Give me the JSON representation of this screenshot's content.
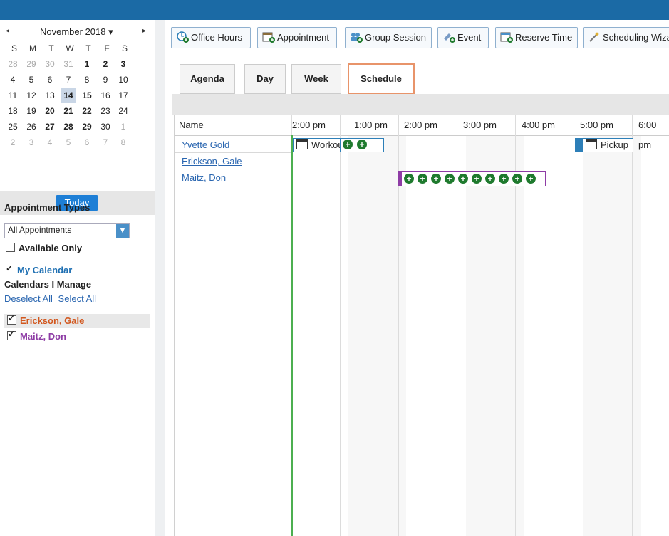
{
  "calendar": {
    "month_label": "November 2018 ▾",
    "prev": "◂",
    "next": "▸",
    "dow": [
      "S",
      "M",
      "T",
      "W",
      "T",
      "F",
      "S"
    ],
    "weeks": [
      [
        "28",
        "29",
        "30",
        "31",
        "1",
        "2",
        "3"
      ],
      [
        "4",
        "5",
        "6",
        "7",
        "8",
        "9",
        "10"
      ],
      [
        "11",
        "12",
        "13",
        "14",
        "15",
        "16",
        "17"
      ],
      [
        "18",
        "19",
        "20",
        "21",
        "22",
        "23",
        "24"
      ],
      [
        "25",
        "26",
        "27",
        "28",
        "29",
        "30",
        "1"
      ],
      [
        "2",
        "3",
        "4",
        "5",
        "6",
        "7",
        "8"
      ]
    ],
    "today_label": "Today"
  },
  "appointment_types": {
    "title": "Appointment Types",
    "selected": "All Appointments",
    "available_only": "Available Only"
  },
  "calendars": {
    "my_calendar": "My Calendar",
    "manage_title": "Calendars I Manage",
    "deselect_all": "Deselect All",
    "select_all": "Select All",
    "managed": [
      {
        "name": "Erickson, Gale",
        "color": "#d2571e"
      },
      {
        "name": "Maitz, Don",
        "color": "#8e3ca5"
      }
    ]
  },
  "toolbar": {
    "office_hours": "Office Hours",
    "appointment": "Appointment",
    "group_session": "Group Session",
    "event": "Event",
    "reserve_time": "Reserve Time",
    "scheduling_wizard": "Scheduling Wiza"
  },
  "tabs": [
    "Agenda",
    "Day",
    "Week",
    "Schedule"
  ],
  "schedule": {
    "name_header": "Name",
    "time_headers": [
      "2:00 pm",
      "1:00 pm",
      "2:00 pm",
      "3:00 pm",
      "4:00 pm",
      "5:00 pm",
      "6:00 pm"
    ],
    "people": [
      "Yvette Gold",
      "Erickson, Gale",
      "Maitz, Don"
    ],
    "appt1_label": "Workou",
    "appt2_label": "Pickup",
    "plus": "+"
  },
  "colors": {
    "topbar": "#1b6aa5",
    "link": "#2a66b0",
    "active_tab_border": "#e8946a",
    "available_green": "#1f7a2e",
    "purple": "#8e3ca5"
  }
}
